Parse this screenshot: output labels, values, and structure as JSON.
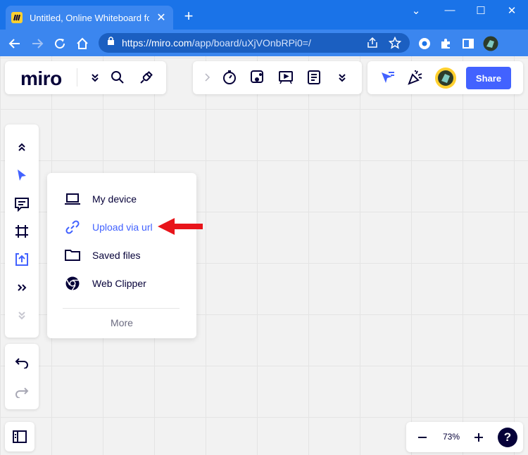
{
  "browser": {
    "tab_title": "Untitled, Online Whiteboard for V",
    "tab_close": "✕",
    "new_tab": "+",
    "url_host": "https://miro.com",
    "url_path": "/app/board/uXjVOnbRPi0=/",
    "window_controls": [
      "⌄",
      "—",
      "☐",
      "✕"
    ]
  },
  "app": {
    "logo": "miro",
    "share_label": "Share"
  },
  "upload_menu": {
    "items": [
      {
        "label": "My device",
        "icon": "laptop-icon"
      },
      {
        "label": "Upload via url",
        "icon": "link-icon",
        "active": true
      },
      {
        "label": "Saved files",
        "icon": "folder-icon"
      },
      {
        "label": "Web Clipper",
        "icon": "chrome-icon"
      }
    ],
    "more_label": "More"
  },
  "zoom": {
    "level": "73%",
    "help": "?"
  },
  "colors": {
    "chrome_blue": "#1a73e8",
    "accent": "#4262ff",
    "arrow": "#e8141a"
  }
}
